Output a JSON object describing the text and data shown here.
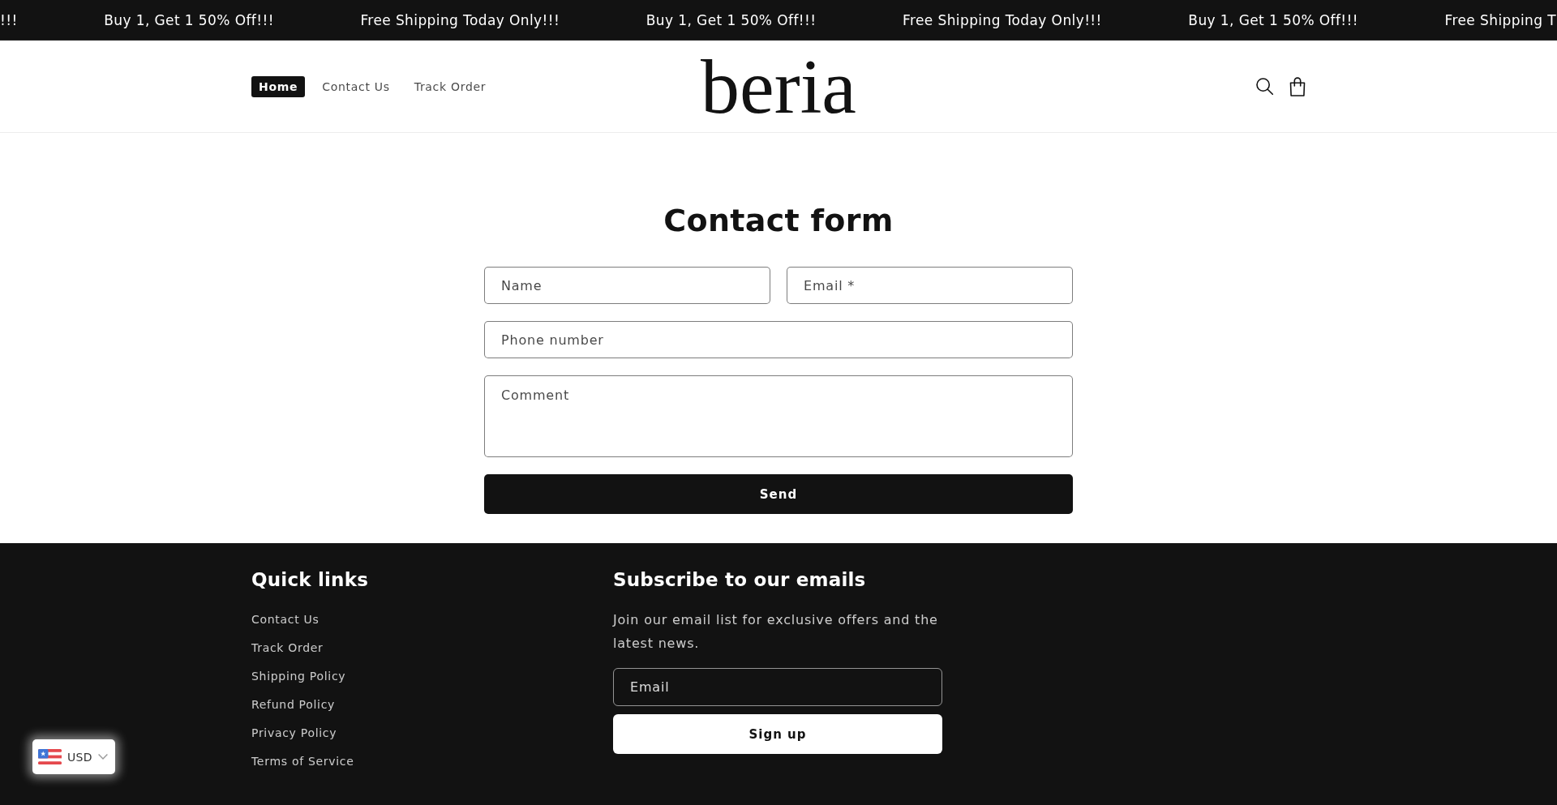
{
  "announcement_bar": {
    "messages": [
      "!!!",
      "Buy 1, Get 1 50% Off!!!",
      "Free Shipping Today Only!!!",
      "Buy 1, Get 1 50% Off!!!",
      "Free Shipping Today Only!!!",
      "Buy 1, Get 1 50% Off!!!",
      "Free Shipping T"
    ]
  },
  "header": {
    "nav": [
      {
        "label": "Home",
        "selected": true
      },
      {
        "label": "Contact Us",
        "selected": false
      },
      {
        "label": "Track Order",
        "selected": false
      }
    ],
    "logo": "beria"
  },
  "contact_form": {
    "title": "Contact form",
    "field_rows": [
      [
        {
          "kind": "input",
          "placeholder": "Name"
        },
        {
          "kind": "input",
          "placeholder": "Email *"
        }
      ],
      [
        {
          "kind": "input",
          "placeholder": "Phone number"
        }
      ],
      [
        {
          "kind": "textarea",
          "placeholder": "Comment"
        }
      ]
    ],
    "submit_button": "Send"
  },
  "footer": {
    "quick_links": {
      "title": "Quick links",
      "links": [
        "Contact Us",
        "Track Order",
        "Shipping Policy",
        "Refund Policy",
        "Privacy Policy",
        "Terms of Service"
      ]
    },
    "newsletter": {
      "title": "Subscribe to our emails",
      "description": "Join our email list for exclusive offers and the latest news.",
      "email_field": {
        "placeholder": "Email"
      },
      "button": "Sign up"
    }
  },
  "currency_selector": {
    "value": "USD"
  }
}
